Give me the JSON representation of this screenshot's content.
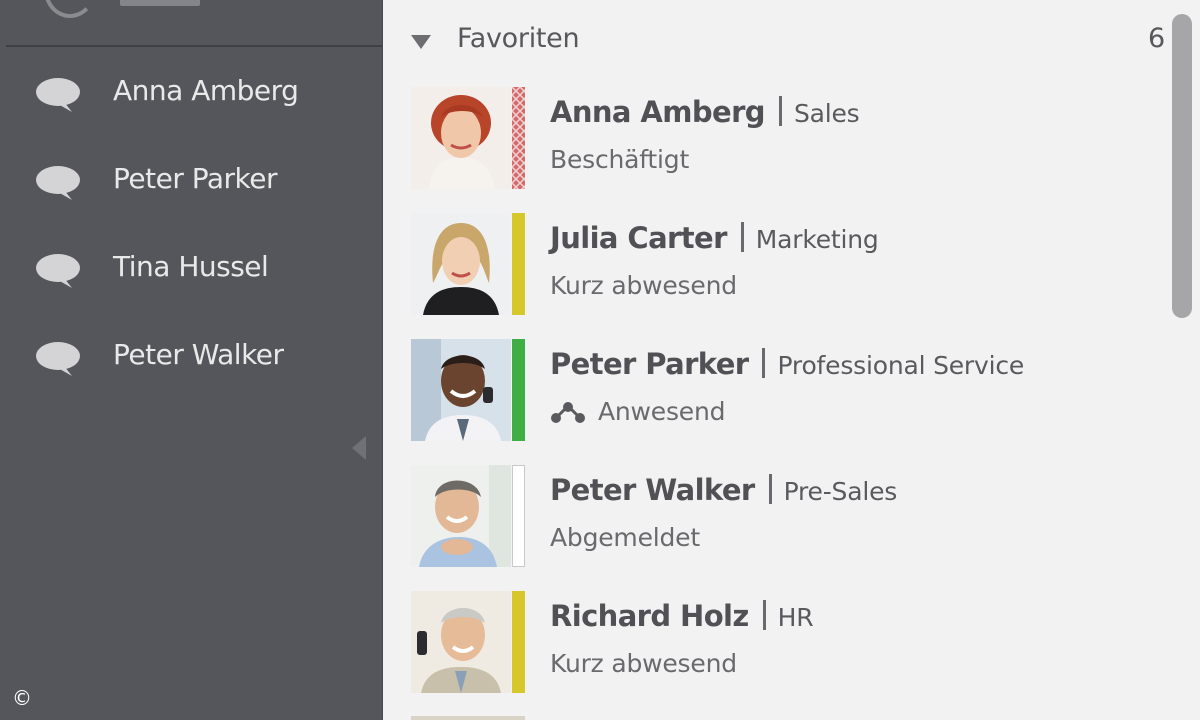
{
  "sidebar": {
    "chats": [
      {
        "name": "Anna Amberg"
      },
      {
        "name": "Peter Parker"
      },
      {
        "name": "Tina Hussel"
      },
      {
        "name": "Peter Walker"
      }
    ],
    "copyright": "©"
  },
  "favorites": {
    "title": "Favoriten",
    "count": "6",
    "contacts": [
      {
        "name": "Anna Amberg",
        "department": "Sales",
        "status": "Beschäftigt",
        "status_color": "#d9534f",
        "status_pattern": "busy"
      },
      {
        "name": "Julia Carter",
        "department": "Marketing",
        "status": "Kurz abwesend",
        "status_color": "#d6c72a"
      },
      {
        "name": "Peter Parker",
        "department": "Professional Service",
        "status": "Anwesend",
        "status_color": "#3fae45",
        "status_icon": "share-icon"
      },
      {
        "name": "Peter Walker",
        "department": "Pre-Sales",
        "status": "Abgemeldet",
        "status_color": "#ffffff"
      },
      {
        "name": "Richard Holz",
        "department": "HR",
        "status": "Kurz abwesend",
        "status_color": "#d6c72a"
      }
    ]
  },
  "colors": {
    "sidebar_bg": "#55565b",
    "main_bg": "#f2f2f2",
    "busy": "#d9534f",
    "away": "#d6c72a",
    "present": "#3fae45",
    "offline": "#ffffff"
  }
}
